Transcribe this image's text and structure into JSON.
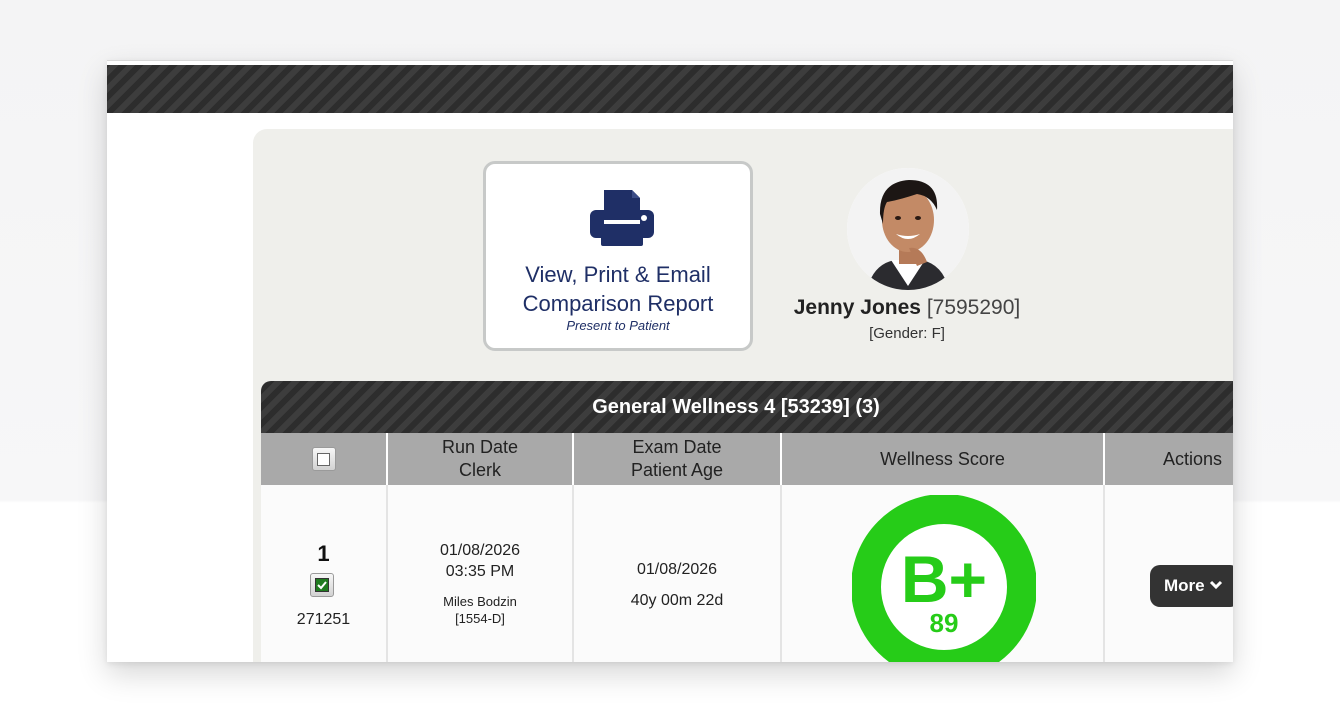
{
  "report_button": {
    "title_line1": "View, Print & Email",
    "title_line2": "Comparison Report",
    "subtitle": "Present to Patient",
    "icon": "printer-icon",
    "color": "#1f2f66"
  },
  "patient": {
    "name": "Jenny Jones",
    "id": "[7595290]",
    "gender": "[Gender: F]"
  },
  "table": {
    "title": "General Wellness 4 [53239] (3)",
    "columns": {
      "run_line1": "Run Date",
      "run_line2": "Clerk",
      "exam_line1": "Exam Date",
      "exam_line2": "Patient Age",
      "score": "Wellness Score",
      "actions": "Actions"
    },
    "rows": [
      {
        "index": "1",
        "checked": true,
        "record_id": "271251",
        "run_date": "01/08/2026",
        "run_time": "03:35 PM",
        "clerk": "Miles Bodzin",
        "clerk_id": "[1554-D]",
        "exam_date": "01/08/2026",
        "patient_age": "40y 00m 22d",
        "grade": "B+",
        "score": "89",
        "grade_color": "#26cc18",
        "more_label": "More"
      }
    ]
  }
}
